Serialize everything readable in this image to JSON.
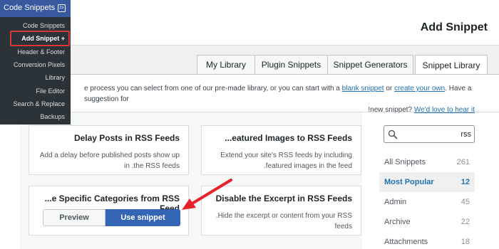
{
  "page": {
    "title": "Add Snippet"
  },
  "admin_menu": {
    "title": "Code Snippets",
    "items": [
      {
        "label": "Code Snippets"
      },
      {
        "label": "Add Snippet +"
      },
      {
        "label": "Header & Footer"
      },
      {
        "label": "Conversion Pixels"
      },
      {
        "label": "Library"
      },
      {
        "label": "File Editor"
      },
      {
        "label": "Search & Replace"
      },
      {
        "label": "Backups"
      }
    ]
  },
  "tabs": [
    {
      "label": "My Library"
    },
    {
      "label": "Plugin Snippets"
    },
    {
      "label": "Snippet Generators"
    },
    {
      "label": "Snippet Library"
    }
  ],
  "notice": {
    "prefix": "e process you can select from one of our pre-made library, or you can start with a",
    "link1": "blank snippet",
    "middle": "or",
    "link2": "create your own",
    "suffix": ". Have a suggestion for",
    "line2_text": "!new snippet?",
    "link3": "We'd love to hear it"
  },
  "cards": [
    {
      "title": "Delay Posts in RSS Feeds",
      "description": "Add a delay before published posts show up in .the RSS feeds"
    },
    {
      "title": "...eatured Images to RSS Feeds",
      "description": "Extend your site's RSS feeds by including .featured images in the feed"
    },
    {
      "title": "...e Specific Categories from RSS Feed",
      "description": ""
    },
    {
      "title": "Disable the Excerpt in RSS Feeds",
      "description": ".Hide the excerpt or content from your RSS feeds"
    }
  ],
  "buttons": {
    "preview": "Preview",
    "use": "Use snippet"
  },
  "search": {
    "value": "rss"
  },
  "categories": [
    {
      "label": "All Snippets",
      "count": "261"
    },
    {
      "label": "Most Popular",
      "count": "12"
    },
    {
      "label": "Admin",
      "count": "45"
    },
    {
      "label": "Archive",
      "count": "22"
    },
    {
      "label": "Attachments",
      "count": "18"
    }
  ],
  "colors": {
    "accent": "#2271b1",
    "admin_bg": "#2c3338",
    "admin_header": "#3858a0",
    "highlight": "#d63638",
    "primary_button": "#3465b4"
  }
}
